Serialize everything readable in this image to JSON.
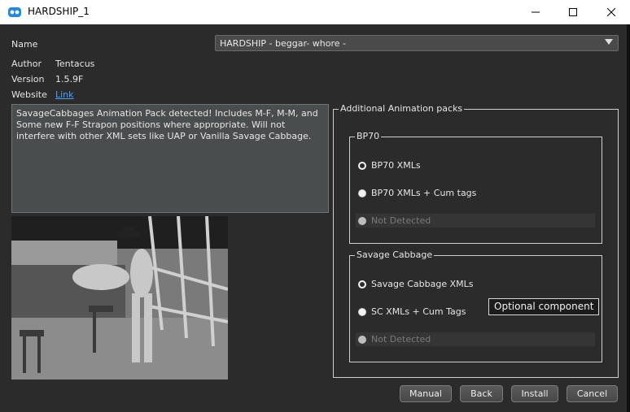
{
  "window": {
    "title": "HARDSHIP_1"
  },
  "fields": {
    "name_label": "Name",
    "name_value": "HARDSHIP - beggar- whore -",
    "author_label": "Author",
    "author_value": "Tentacus",
    "version_label": "Version",
    "version_value": "1.5.9F",
    "website_label": "Website",
    "website_link": "Link"
  },
  "description": "SavageCabbages Animation Pack detected! Includes M-F, M-M, and Some new F-F Strapon positions where appropriate. Will not interfere with other XML sets like UAP or Vanilla Savage Cabbage.",
  "packs": {
    "title": "Additional Animation packs",
    "bp70": {
      "title": "BP70",
      "options": [
        "BP70 XMLs",
        "BP70 XMLs + Cum tags",
        "Not Detected"
      ]
    },
    "savage": {
      "title": "Savage Cabbage",
      "options": [
        "Savage Cabbage XMLs",
        "SC XMLs + Cum Tags",
        "Not Detected"
      ]
    }
  },
  "tooltip": "Optional component",
  "buttons": {
    "manual": "Manual",
    "back": "Back",
    "install": "Install",
    "cancel": "Cancel"
  }
}
